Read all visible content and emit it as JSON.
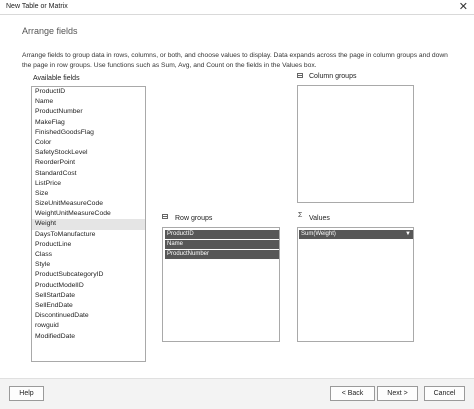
{
  "window": {
    "title": "New Table or Matrix"
  },
  "page": {
    "heading": "Arrange fields",
    "description": "Arrange fields to group data in rows, columns, or both, and choose values to display. Data expands across the page in column groups and down the page in row groups.  Use functions such as Sum, Avg, and Count on the fields in the Values box."
  },
  "available_fields": {
    "label": "Available fields",
    "items": [
      "ProductID",
      "Name",
      "ProductNumber",
      "MakeFlag",
      "FinishedGoodsFlag",
      "Color",
      "SafetyStockLevel",
      "ReorderPoint",
      "StandardCost",
      "ListPrice",
      "Size",
      "SizeUnitMeasureCode",
      "WeightUnitMeasureCode",
      "Weight",
      "DaysToManufacture",
      "ProductLine",
      "Class",
      "Style",
      "ProductSubcategoryID",
      "ProductModelID",
      "SellStartDate",
      "SellEndDate",
      "DiscontinuedDate",
      "rowguid",
      "ModifiedDate"
    ],
    "selected": "Weight"
  },
  "column_groups": {
    "label": "Column groups",
    "items": []
  },
  "row_groups": {
    "label": "Row groups",
    "items": [
      "ProductID",
      "Name",
      "ProductNumber"
    ]
  },
  "values": {
    "label": "Values",
    "icon": "sigma-icon",
    "items": [
      "Sum(Weight)"
    ]
  },
  "buttons": {
    "help": "Help",
    "back": "< Back",
    "next": "Next >",
    "cancel": "Cancel"
  }
}
